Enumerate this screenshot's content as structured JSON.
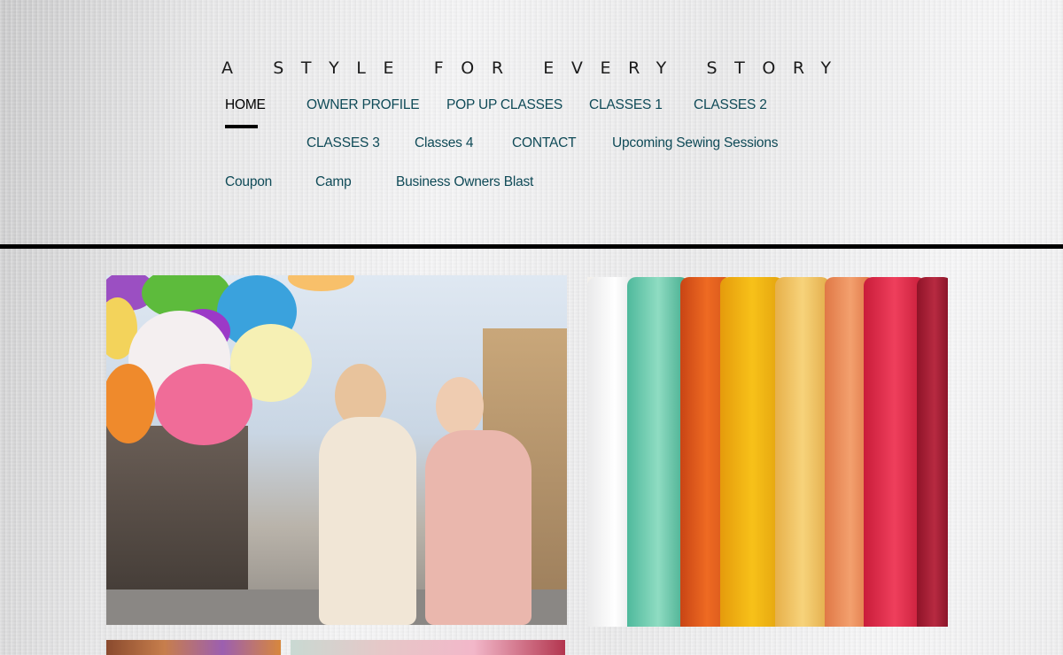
{
  "header": {
    "tagline": "A STYLE FOR EVERY STORY"
  },
  "nav": {
    "items": [
      {
        "label": "HOME",
        "active": true
      },
      {
        "label": "OWNER PROFILE"
      },
      {
        "label": "POP UP CLASSES"
      },
      {
        "label": "CLASSES 1"
      },
      {
        "label": "CLASSES 2"
      },
      {
        "label": "CLASSES 3"
      },
      {
        "label": "Classes 4"
      },
      {
        "label": "CONTACT"
      },
      {
        "label": "Upcoming Sewing Sessions"
      },
      {
        "label": "Coupon"
      },
      {
        "label": "Camp"
      },
      {
        "label": "Business Owners Blast"
      }
    ]
  },
  "colors": {
    "nav_link": "#0f4a57",
    "nav_active": "#000000",
    "divider": "#000000"
  }
}
